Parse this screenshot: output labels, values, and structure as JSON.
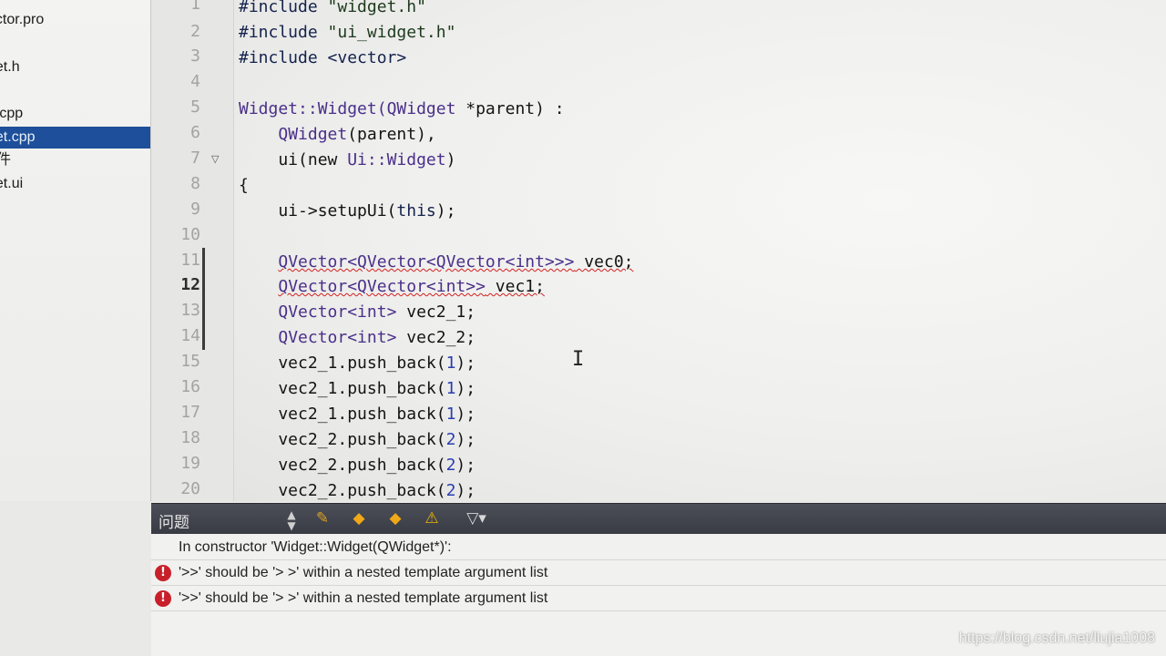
{
  "project_tree": {
    "items": [
      {
        "label": "ector.pro"
      },
      {
        "label": "get.h"
      },
      {
        "label": "n.cpp"
      },
      {
        "label": "get.cpp"
      },
      {
        "label": "件"
      },
      {
        "label": "get.ui"
      }
    ]
  },
  "editor": {
    "current_line": "12",
    "line_numbers": [
      "1",
      "2",
      "3",
      "4",
      "5",
      "6",
      "7",
      "8",
      "9",
      "10",
      "11",
      "12",
      "13",
      "14",
      "15",
      "16",
      "17",
      "18",
      "19",
      "20"
    ],
    "lines": {
      "l1_a": "#include ",
      "l1_b": "\"widget.h\"",
      "l2_a": "#include ",
      "l2_b": "\"ui_widget.h\"",
      "l3": "#include <vector>",
      "l5_a": "Widget::Widget(",
      "l5_b": "QWidget",
      "l5_c": " *parent) :",
      "l6_a": "    ",
      "l6_b": "QWidget",
      "l6_c": "(parent),",
      "l7_a": "    ui(new ",
      "l7_b": "Ui::Widget",
      "l7_c": ")",
      "l8": "{",
      "l9_a": "    ui->setupUi(",
      "l9_b": "this",
      "l9_c": ");",
      "l11_a": "    ",
      "l11_b": "QVector<QVector<QVector<int>>>",
      "l11_c": " vec0;",
      "l12_a": "    ",
      "l12_b": "QVector<QVector<int>>",
      "l12_c": " vec1;",
      "l13_a": "    ",
      "l13_b": "QVector<int>",
      "l13_c": " vec2_1;",
      "l14_a": "    ",
      "l14_b": "QVector<int>",
      "l14_c": " vec2_2;",
      "l15_a": "    vec2_1.push_back(",
      "l15_b": "1",
      "l15_c": ");",
      "l16_a": "    vec2_1.push_back(",
      "l16_b": "1",
      "l16_c": ");",
      "l17_a": "    vec2_1.push_back(",
      "l17_b": "1",
      "l17_c": ");",
      "l18_a": "    vec2_2.push_back(",
      "l18_b": "2",
      "l18_c": ");",
      "l19_a": "    vec2_2.push_back(",
      "l19_b": "2",
      "l19_c": ");",
      "l20_a": "    vec2_2.push_back(",
      "l20_b": "2",
      "l20_c": ");"
    }
  },
  "issues": {
    "title": "问题",
    "context": "In constructor 'Widget::Widget(QWidget*)':",
    "errors": [
      {
        "text": "'>>' should be '> >' within a nested template argument list"
      },
      {
        "text": "'>>' should be '> >' within a nested template argument list"
      }
    ]
  },
  "watermark": "https://blog.csdn.net/liujia1008",
  "colors": {
    "selection": "#1d4f9a",
    "error": "#c8202a",
    "warning": "#f0b400"
  }
}
